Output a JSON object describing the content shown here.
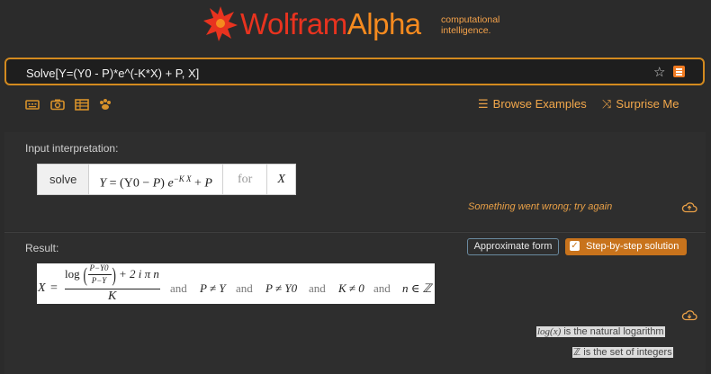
{
  "logo": {
    "wolfram": "Wolfram",
    "alpha": "Alpha",
    "tagline_1": "computational",
    "tagline_2": "intelligence."
  },
  "search": {
    "query": "Solve[Y=(Y0 - P)*e^(-K*X) + P, X]"
  },
  "toolbar": {
    "tools": [
      "keyboard-icon",
      "camera-icon",
      "table-icon",
      "paw-icon"
    ],
    "browse_label": "Browse Examples",
    "surprise_label": "Surprise Me"
  },
  "interpretation": {
    "title": "Input interpretation:",
    "command": "solve",
    "eq_lhs": "Y",
    "eq_eq": " = (Y0 − ",
    "eq_p": "P",
    "eq_close": ") ",
    "eq_e": "e",
    "eq_exp": "−K X",
    "eq_plus": " + ",
    "eq_p2": "P",
    "for": "for",
    "variable": "X",
    "error": "Something went wrong; try again"
  },
  "result": {
    "title": "Result:",
    "approx_label": "Approximate form",
    "step_label": "Step-by-step solution",
    "lhs": "X",
    "eq": "=",
    "log": "log",
    "frac_num": "P−Y0",
    "frac_den": "P−Y",
    "plus_term": "+ 2 i π n",
    "denominator": "K",
    "and1": "and",
    "cond1": "P ≠ Y",
    "and2": "and",
    "cond2": "P ≠ Y0",
    "and3": "and",
    "cond3": "K ≠ 0",
    "and4": "and",
    "cond4": "n ∈ ℤ",
    "note1_math": "log(x)",
    "note1_text": " is the natural logarithm",
    "note2_math": "ℤ",
    "note2_text": " is the set of integers"
  },
  "colors": {
    "accent_red": "#e8331f",
    "accent_orange": "#f58a1f",
    "background": "#2b2b2b"
  }
}
